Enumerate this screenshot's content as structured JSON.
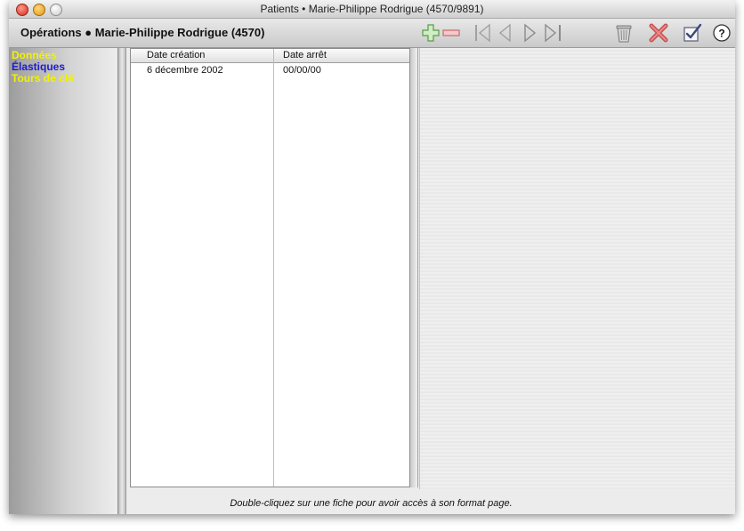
{
  "window": {
    "title": "Patients • Marie-Philippe Rodrigue (4570/9891)"
  },
  "toolbar": {
    "title": "Opérations ●  Marie-Philippe Rodrigue (4570)",
    "buttons": [
      {
        "name": "add-icon"
      },
      {
        "name": "remove-icon"
      },
      {
        "name": "first-record-icon"
      },
      {
        "name": "previous-record-icon"
      },
      {
        "name": "next-record-icon"
      },
      {
        "name": "last-record-icon"
      },
      {
        "name": "trash-icon"
      },
      {
        "name": "cancel-icon"
      },
      {
        "name": "validate-icon"
      },
      {
        "name": "help-icon"
      }
    ]
  },
  "sidebar": {
    "items": [
      {
        "label": "Données",
        "color": "#f2f200"
      },
      {
        "label": "Élastiques",
        "color": "#1c1ccc"
      },
      {
        "label": "Tours de clé",
        "color": "#f2f200"
      }
    ]
  },
  "table": {
    "columns": [
      "Date création",
      "Date arrêt"
    ],
    "rows": [
      [
        "6 décembre 2002",
        "00/00/00"
      ]
    ]
  },
  "footer": {
    "hint": "Double-cliquez sur une fiche pour avoir accès à son format page."
  }
}
